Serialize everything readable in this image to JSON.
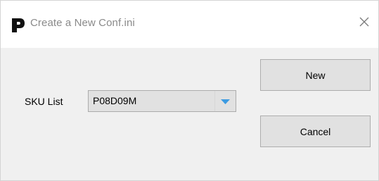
{
  "window": {
    "title": "Create a New Conf.ini",
    "app_icon_letter": "P",
    "icons": {
      "app": "p-logo-icon",
      "close": "close-icon",
      "dropdown": "chevron-down-icon"
    }
  },
  "form": {
    "sku_label": "SKU List",
    "sku_selected": "P08D09M"
  },
  "buttons": {
    "new_label": "New",
    "cancel_label": "Cancel"
  },
  "colors": {
    "dropdown_arrow": "#3c9be1",
    "title_text": "#8a8a8a"
  }
}
